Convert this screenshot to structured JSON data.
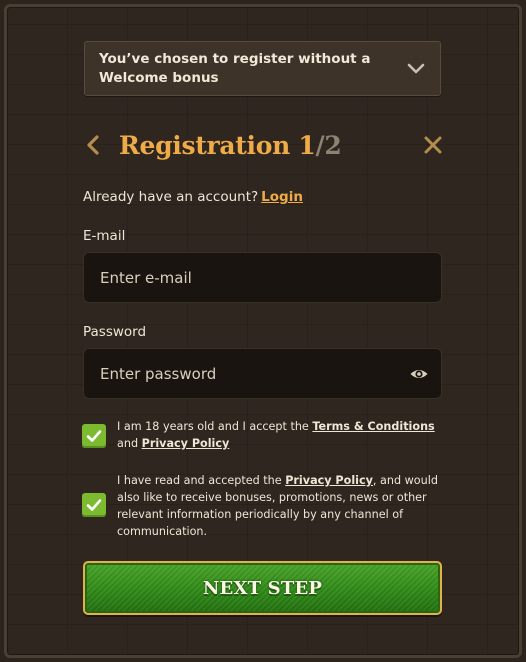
{
  "bonus": {
    "line1": "You’ve chosen to register without a",
    "line2": "Welcome bonus",
    "chevron_icon": "chevron-down-icon"
  },
  "header": {
    "title": "Registration",
    "step_current": "1",
    "step_separator": "/",
    "step_total": "2",
    "back_icon": "chevron-left-icon",
    "close_icon": "close-icon"
  },
  "account": {
    "prompt": "Already have an account?",
    "login_label": "Login"
  },
  "email": {
    "label": "E-mail",
    "placeholder": "Enter e-mail",
    "value": ""
  },
  "password": {
    "label": "Password",
    "placeholder": "Enter password",
    "value": "",
    "visibility_icon": "eye-icon"
  },
  "consents": [
    {
      "checked": true,
      "text_before": "I am 18 years old and I accept the",
      "link1": "Terms & Conditions",
      "text_middle": "and",
      "link2": "Privacy Policy"
    },
    {
      "checked": true,
      "text_before": "I have read and accepted the",
      "link1": "Privacy Policy",
      "text_after": ", and would also like to receive bonuses, promotions, news or other relevant information periodically by any channel of communication."
    }
  ],
  "submit": {
    "label": "NEXT STEP"
  },
  "colors": {
    "accent": "#eeab48",
    "background": "#2e261f",
    "checkbox": "#7cbb2f",
    "button_green": "#2f8a17",
    "button_border": "#e2b24a"
  }
}
